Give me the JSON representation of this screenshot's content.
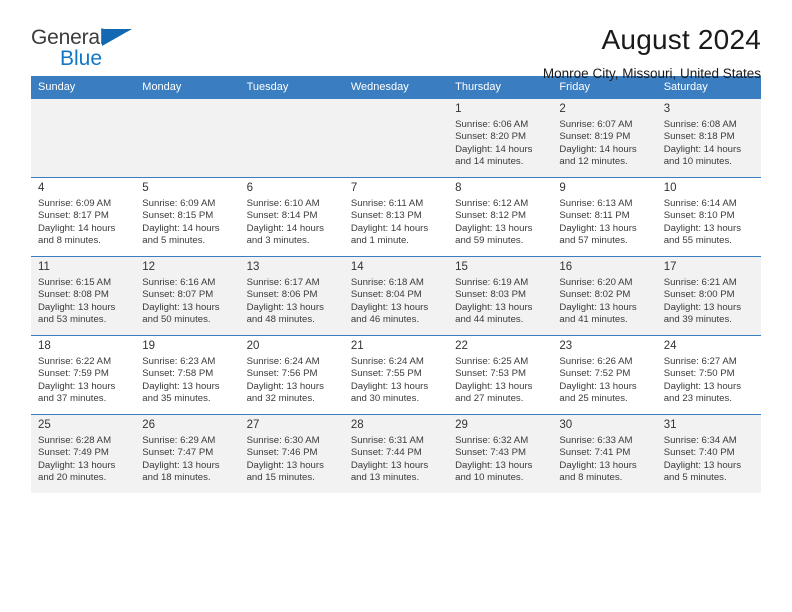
{
  "brand": {
    "name_top": "General",
    "name_bottom": "Blue",
    "triangle_color": "#1268b3"
  },
  "header": {
    "title": "August 2024",
    "subtitle": "Monroe City, Missouri, United States"
  },
  "colors": {
    "header_row": "#3a7dc0",
    "shaded_row": "#f2f2f2",
    "text": "#3b3b3b"
  },
  "weekday_headers": [
    "Sunday",
    "Monday",
    "Tuesday",
    "Wednesday",
    "Thursday",
    "Friday",
    "Saturday"
  ],
  "labels": {
    "sunrise": "Sunrise:",
    "sunset": "Sunset:",
    "daylight": "Daylight:"
  },
  "weeks": [
    [
      {
        "day": "",
        "sunrise": "",
        "sunset": "",
        "daylight_line1": "",
        "daylight_line2": ""
      },
      {
        "day": "",
        "sunrise": "",
        "sunset": "",
        "daylight_line1": "",
        "daylight_line2": ""
      },
      {
        "day": "",
        "sunrise": "",
        "sunset": "",
        "daylight_line1": "",
        "daylight_line2": ""
      },
      {
        "day": "",
        "sunrise": "",
        "sunset": "",
        "daylight_line1": "",
        "daylight_line2": ""
      },
      {
        "day": "1",
        "sunrise": "Sunrise: 6:06 AM",
        "sunset": "Sunset: 8:20 PM",
        "daylight_line1": "Daylight: 14 hours",
        "daylight_line2": "and 14 minutes."
      },
      {
        "day": "2",
        "sunrise": "Sunrise: 6:07 AM",
        "sunset": "Sunset: 8:19 PM",
        "daylight_line1": "Daylight: 14 hours",
        "daylight_line2": "and 12 minutes."
      },
      {
        "day": "3",
        "sunrise": "Sunrise: 6:08 AM",
        "sunset": "Sunset: 8:18 PM",
        "daylight_line1": "Daylight: 14 hours",
        "daylight_line2": "and 10 minutes."
      }
    ],
    [
      {
        "day": "4",
        "sunrise": "Sunrise: 6:09 AM",
        "sunset": "Sunset: 8:17 PM",
        "daylight_line1": "Daylight: 14 hours",
        "daylight_line2": "and 8 minutes."
      },
      {
        "day": "5",
        "sunrise": "Sunrise: 6:09 AM",
        "sunset": "Sunset: 8:15 PM",
        "daylight_line1": "Daylight: 14 hours",
        "daylight_line2": "and 5 minutes."
      },
      {
        "day": "6",
        "sunrise": "Sunrise: 6:10 AM",
        "sunset": "Sunset: 8:14 PM",
        "daylight_line1": "Daylight: 14 hours",
        "daylight_line2": "and 3 minutes."
      },
      {
        "day": "7",
        "sunrise": "Sunrise: 6:11 AM",
        "sunset": "Sunset: 8:13 PM",
        "daylight_line1": "Daylight: 14 hours",
        "daylight_line2": "and 1 minute."
      },
      {
        "day": "8",
        "sunrise": "Sunrise: 6:12 AM",
        "sunset": "Sunset: 8:12 PM",
        "daylight_line1": "Daylight: 13 hours",
        "daylight_line2": "and 59 minutes."
      },
      {
        "day": "9",
        "sunrise": "Sunrise: 6:13 AM",
        "sunset": "Sunset: 8:11 PM",
        "daylight_line1": "Daylight: 13 hours",
        "daylight_line2": "and 57 minutes."
      },
      {
        "day": "10",
        "sunrise": "Sunrise: 6:14 AM",
        "sunset": "Sunset: 8:10 PM",
        "daylight_line1": "Daylight: 13 hours",
        "daylight_line2": "and 55 minutes."
      }
    ],
    [
      {
        "day": "11",
        "sunrise": "Sunrise: 6:15 AM",
        "sunset": "Sunset: 8:08 PM",
        "daylight_line1": "Daylight: 13 hours",
        "daylight_line2": "and 53 minutes."
      },
      {
        "day": "12",
        "sunrise": "Sunrise: 6:16 AM",
        "sunset": "Sunset: 8:07 PM",
        "daylight_line1": "Daylight: 13 hours",
        "daylight_line2": "and 50 minutes."
      },
      {
        "day": "13",
        "sunrise": "Sunrise: 6:17 AM",
        "sunset": "Sunset: 8:06 PM",
        "daylight_line1": "Daylight: 13 hours",
        "daylight_line2": "and 48 minutes."
      },
      {
        "day": "14",
        "sunrise": "Sunrise: 6:18 AM",
        "sunset": "Sunset: 8:04 PM",
        "daylight_line1": "Daylight: 13 hours",
        "daylight_line2": "and 46 minutes."
      },
      {
        "day": "15",
        "sunrise": "Sunrise: 6:19 AM",
        "sunset": "Sunset: 8:03 PM",
        "daylight_line1": "Daylight: 13 hours",
        "daylight_line2": "and 44 minutes."
      },
      {
        "day": "16",
        "sunrise": "Sunrise: 6:20 AM",
        "sunset": "Sunset: 8:02 PM",
        "daylight_line1": "Daylight: 13 hours",
        "daylight_line2": "and 41 minutes."
      },
      {
        "day": "17",
        "sunrise": "Sunrise: 6:21 AM",
        "sunset": "Sunset: 8:00 PM",
        "daylight_line1": "Daylight: 13 hours",
        "daylight_line2": "and 39 minutes."
      }
    ],
    [
      {
        "day": "18",
        "sunrise": "Sunrise: 6:22 AM",
        "sunset": "Sunset: 7:59 PM",
        "daylight_line1": "Daylight: 13 hours",
        "daylight_line2": "and 37 minutes."
      },
      {
        "day": "19",
        "sunrise": "Sunrise: 6:23 AM",
        "sunset": "Sunset: 7:58 PM",
        "daylight_line1": "Daylight: 13 hours",
        "daylight_line2": "and 35 minutes."
      },
      {
        "day": "20",
        "sunrise": "Sunrise: 6:24 AM",
        "sunset": "Sunset: 7:56 PM",
        "daylight_line1": "Daylight: 13 hours",
        "daylight_line2": "and 32 minutes."
      },
      {
        "day": "21",
        "sunrise": "Sunrise: 6:24 AM",
        "sunset": "Sunset: 7:55 PM",
        "daylight_line1": "Daylight: 13 hours",
        "daylight_line2": "and 30 minutes."
      },
      {
        "day": "22",
        "sunrise": "Sunrise: 6:25 AM",
        "sunset": "Sunset: 7:53 PM",
        "daylight_line1": "Daylight: 13 hours",
        "daylight_line2": "and 27 minutes."
      },
      {
        "day": "23",
        "sunrise": "Sunrise: 6:26 AM",
        "sunset": "Sunset: 7:52 PM",
        "daylight_line1": "Daylight: 13 hours",
        "daylight_line2": "and 25 minutes."
      },
      {
        "day": "24",
        "sunrise": "Sunrise: 6:27 AM",
        "sunset": "Sunset: 7:50 PM",
        "daylight_line1": "Daylight: 13 hours",
        "daylight_line2": "and 23 minutes."
      }
    ],
    [
      {
        "day": "25",
        "sunrise": "Sunrise: 6:28 AM",
        "sunset": "Sunset: 7:49 PM",
        "daylight_line1": "Daylight: 13 hours",
        "daylight_line2": "and 20 minutes."
      },
      {
        "day": "26",
        "sunrise": "Sunrise: 6:29 AM",
        "sunset": "Sunset: 7:47 PM",
        "daylight_line1": "Daylight: 13 hours",
        "daylight_line2": "and 18 minutes."
      },
      {
        "day": "27",
        "sunrise": "Sunrise: 6:30 AM",
        "sunset": "Sunset: 7:46 PM",
        "daylight_line1": "Daylight: 13 hours",
        "daylight_line2": "and 15 minutes."
      },
      {
        "day": "28",
        "sunrise": "Sunrise: 6:31 AM",
        "sunset": "Sunset: 7:44 PM",
        "daylight_line1": "Daylight: 13 hours",
        "daylight_line2": "and 13 minutes."
      },
      {
        "day": "29",
        "sunrise": "Sunrise: 6:32 AM",
        "sunset": "Sunset: 7:43 PM",
        "daylight_line1": "Daylight: 13 hours",
        "daylight_line2": "and 10 minutes."
      },
      {
        "day": "30",
        "sunrise": "Sunrise: 6:33 AM",
        "sunset": "Sunset: 7:41 PM",
        "daylight_line1": "Daylight: 13 hours",
        "daylight_line2": "and 8 minutes."
      },
      {
        "day": "31",
        "sunrise": "Sunrise: 6:34 AM",
        "sunset": "Sunset: 7:40 PM",
        "daylight_line1": "Daylight: 13 hours",
        "daylight_line2": "and 5 minutes."
      }
    ]
  ]
}
